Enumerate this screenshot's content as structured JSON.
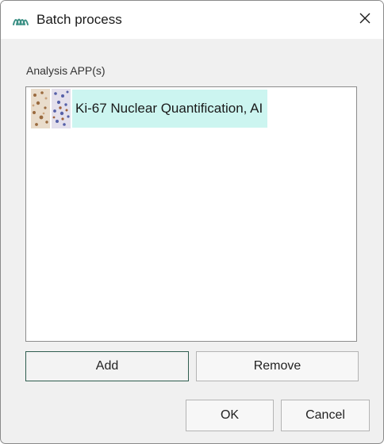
{
  "window": {
    "title": "Batch process",
    "icon": "app-waves-icon",
    "close_icon": "close-icon"
  },
  "analysis": {
    "label": "Analysis APP(s)",
    "items": [
      {
        "label": "Ki-67 Nuclear Quantification, AI",
        "selected": true,
        "thumbnail": "tissue-thumbnail-icon"
      }
    ]
  },
  "buttons": {
    "add": "Add",
    "remove": "Remove",
    "ok": "OK",
    "cancel": "Cancel"
  },
  "colors": {
    "selection": "#ccf5f0",
    "accent_border": "#2f5d4f",
    "brand_icon": "#3a8f84"
  }
}
